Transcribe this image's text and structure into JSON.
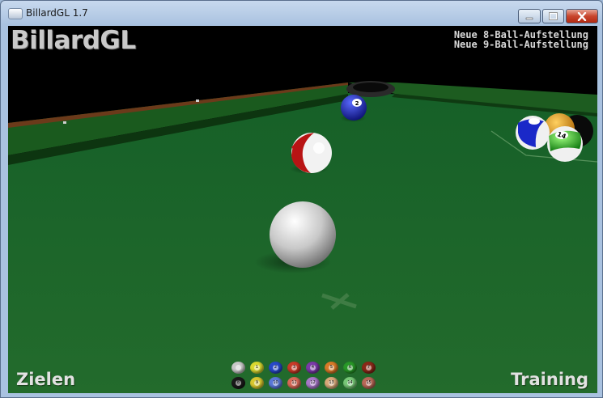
{
  "window": {
    "title": "BillardGL 1.7",
    "icon": "app-icon",
    "controls": {
      "minimize_icon": "minimize-icon",
      "maximize_icon": "maximize-icon",
      "close_icon": "close-icon"
    }
  },
  "game": {
    "logo": "BillardGL",
    "menu": [
      "Neue 8-Ball-Aufstellung",
      "Neue 9-Ball-Aufstellung"
    ],
    "mode_left": "Zielen",
    "mode_right": "Training",
    "colors": {
      "felt": "#1f6a2a",
      "rail": "#18551f",
      "wood": "#6b3a1a",
      "background": "#000000"
    },
    "balls_visible": [
      {
        "name": "cue-ball",
        "color": "#e8e8e8"
      },
      {
        "name": "ball-2",
        "color": "#1a28c8"
      },
      {
        "name": "ball-11",
        "color": "#c81a1a",
        "striped": true
      },
      {
        "name": "ball-10",
        "color": "#1a28c8",
        "striped": true
      },
      {
        "name": "ball-9",
        "color": "#f0a000"
      },
      {
        "name": "ball-14",
        "color": "#20c020",
        "striped": true
      },
      {
        "name": "ball-8",
        "color": "#111111"
      }
    ],
    "ball_tray": {
      "top_row": [
        {
          "label": "",
          "color": "#c8c8c8"
        },
        {
          "label": "1",
          "color": "#d8d830"
        },
        {
          "label": "2",
          "color": "#2848c8"
        },
        {
          "label": "3",
          "color": "#c83a28"
        },
        {
          "label": "4",
          "color": "#7a3aa8"
        },
        {
          "label": "5",
          "color": "#d87a28"
        },
        {
          "label": "6",
          "color": "#289828"
        },
        {
          "label": "7",
          "color": "#8a2818"
        }
      ],
      "bottom_row": [
        {
          "label": "8",
          "color": "#1a1a1a"
        },
        {
          "label": "9",
          "color": "#d8c830"
        },
        {
          "label": "10",
          "color": "#5a78d8"
        },
        {
          "label": "11",
          "color": "#d86a58"
        },
        {
          "label": "12",
          "color": "#a878c8"
        },
        {
          "label": "13",
          "color": "#d8a878"
        },
        {
          "label": "14",
          "color": "#78c878"
        },
        {
          "label": "15",
          "color": "#b86858"
        }
      ]
    }
  }
}
